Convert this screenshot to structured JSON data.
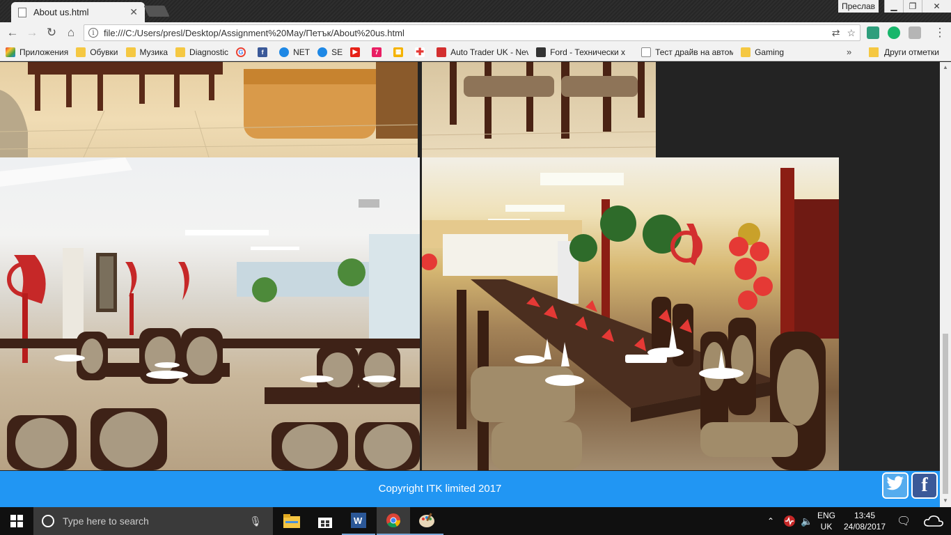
{
  "browser": {
    "tab_title": "About us.html",
    "profile_name": "Преслав",
    "url": "file:///C:/Users/presl/Desktop/Assignment%20May/Петък/About%20us.html"
  },
  "bookmarks": {
    "items": [
      {
        "label": "Приложения",
        "icon": "apps-grid-icon"
      },
      {
        "label": "Обувки",
        "icon": "folder-icon"
      },
      {
        "label": "Музика",
        "icon": "folder-icon"
      },
      {
        "label": "Diagnostic",
        "icon": "folder-icon"
      },
      {
        "label": "",
        "icon": "google-icon"
      },
      {
        "label": "",
        "icon": "facebook-icon"
      },
      {
        "label": "NET",
        "icon": "globe-icon"
      },
      {
        "label": "SE",
        "icon": "globe-icon"
      },
      {
        "label": "",
        "icon": "youtube-icon"
      },
      {
        "label": "",
        "icon": "seven-icon"
      },
      {
        "label": "",
        "icon": "grid-icon"
      },
      {
        "label": "",
        "icon": "red-cross-icon"
      },
      {
        "label": "Auto Trader UK - Nev",
        "icon": "autotrader-icon"
      },
      {
        "label": "Ford - Технически х",
        "icon": "ford-icon"
      },
      {
        "label": "Тест драйв на автом",
        "icon": "page-icon"
      },
      {
        "label": "Gaming",
        "icon": "folder-icon"
      }
    ],
    "more": "»",
    "other": "Други отметки"
  },
  "footer": {
    "copyright": "Copyright ITK limited 2017"
  },
  "taskbar": {
    "search_placeholder": "Type here to search",
    "lang_line1": "ENG",
    "lang_line2": "UK",
    "time": "13:45",
    "date": "24/08/2017"
  },
  "colors": {
    "footer": "#2196f3",
    "page_background": "#232323"
  }
}
